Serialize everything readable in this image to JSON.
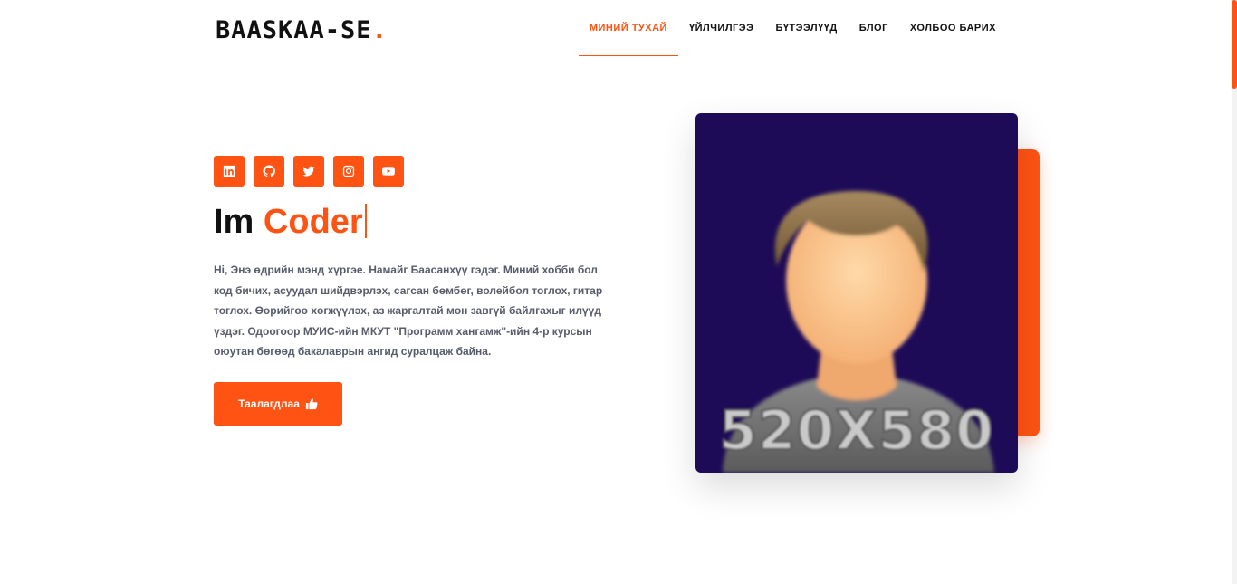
{
  "site": {
    "logo_text": "BAASKAA-SE",
    "logo_dot": ".",
    "accent_color": "#ff5313"
  },
  "nav": {
    "items": [
      {
        "label": "МИНИЙ ТУХАЙ",
        "active": true
      },
      {
        "label": "ҮЙЛЧИЛГЭЭ"
      },
      {
        "label": "БҮТЭЭЛҮҮД"
      },
      {
        "label": "БЛОГ"
      },
      {
        "label": "ХОЛБОО БАРИХ"
      }
    ]
  },
  "hero": {
    "socials": [
      {
        "icon": "linkedin-icon"
      },
      {
        "icon": "github-icon"
      },
      {
        "icon": "twitter-icon"
      },
      {
        "icon": "instagram-icon"
      },
      {
        "icon": "youtube-icon"
      }
    ],
    "headline_prefix": "Im",
    "headline_role": "Coder",
    "bio": "Hi, Энэ өдрийн мэнд хүргэе. Намайг Баасанхүү гэдэг. Миний хобби бол код бичих, асуудал шийдвэрлэх, сагсан бөмбөг, волейбол тоглох, гитар тоглох. Өөрийгөө хөгжүүлэх, аз жаргалтай мөн завгүй байлгахыг илүүд үздэг. Одоогоор МУИС-ийн МКУТ \"Программ хангамж\"-ийн 4-р курсын оюутан бөгөөд бакалаврын ангид суралцаж байна.",
    "button_label": "Таалагдлаа",
    "button_icon": "thumbs-up-icon",
    "photo_text": "520X580"
  }
}
